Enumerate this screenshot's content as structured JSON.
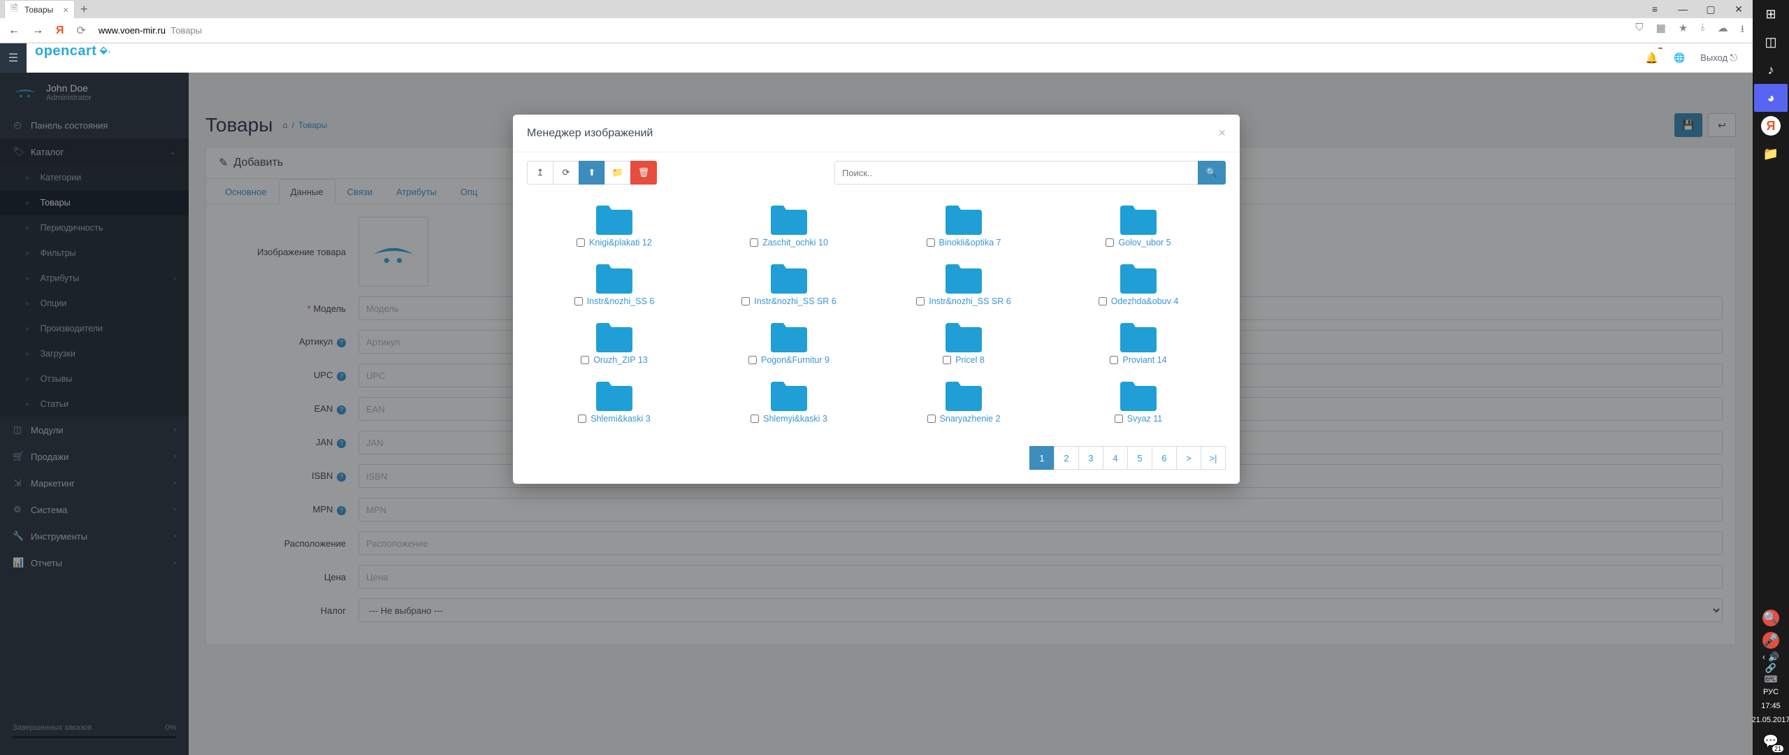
{
  "browser": {
    "tab_title": "Товары",
    "url_host": "www.voen-mir.ru",
    "url_path": "Товары"
  },
  "topbar": {
    "logo": "opencart",
    "logout": "Выход"
  },
  "user": {
    "name": "John Doe",
    "role": "Administrator"
  },
  "nav": {
    "dashboard": "Панель состояния",
    "catalog": "Каталог",
    "sub": {
      "categories": "Категории",
      "products": "Товары",
      "recurring": "Периодичность",
      "filters": "Фильтры",
      "attributes": "Атрибуты",
      "options": "Опции",
      "manufacturers": "Производители",
      "downloads": "Загрузки",
      "reviews": "Отзывы",
      "information": "Статьи"
    },
    "extensions": "Модули",
    "sales": "Продажи",
    "marketing": "Маркетинг",
    "system": "Система",
    "tools": "Инструменты",
    "reports": "Отчеты"
  },
  "progress": {
    "label": "Завершенных заказов",
    "value": "0%"
  },
  "page": {
    "title": "Товары",
    "breadcrumb": "Товары",
    "panel_title": "Добавить"
  },
  "tabs": {
    "general": "Основное",
    "data": "Данные",
    "links": "Связи",
    "attribute": "Атрибуты",
    "option": "Опц"
  },
  "form": {
    "image": "Изображение товара",
    "model": "Модель",
    "model_ph": "Модель",
    "sku": "Артикул",
    "sku_ph": "Артикул",
    "upc": "UPC",
    "upc_ph": "UPC",
    "ean": "EAN",
    "ean_ph": "EAN",
    "jan": "JAN",
    "jan_ph": "JAN",
    "isbn": "ISBN",
    "isbn_ph": "ISBN",
    "mpn": "MPN",
    "mpn_ph": "MPN",
    "location": "Расположение",
    "location_ph": "Расположение",
    "price": "Цена",
    "price_ph": "Цена",
    "tax": "Налог",
    "tax_sel": "--- Не выбрано ---"
  },
  "modal": {
    "title": "Менеджер изображений",
    "search_ph": "Поиск..",
    "folders": [
      "Knigi&plakati 12",
      "Zaschit_ochki 10",
      "Binokli&optika 7",
      "Golov_ubor 5",
      "Instr&nozhi_SS 6",
      "Instr&nozhi_SS SR 6",
      "Instr&nozhi_SS SR 6",
      "Odezhda&obuv 4",
      "Oruzh_ZIP 13",
      "Pogon&Furnitur 9",
      "Pricel 8",
      "Proviant 14",
      "Shlemi&kaski 3",
      "Shlemyi&kaski 3",
      "Snaryazhenie 2",
      "Svyaz 11"
    ],
    "pages": [
      "1",
      "2",
      "3",
      "4",
      "5",
      "6",
      ">",
      ">|"
    ]
  },
  "taskbar": {
    "time": "17:45",
    "date": "21.05.2017",
    "lang": "РУС",
    "badge": "21"
  }
}
